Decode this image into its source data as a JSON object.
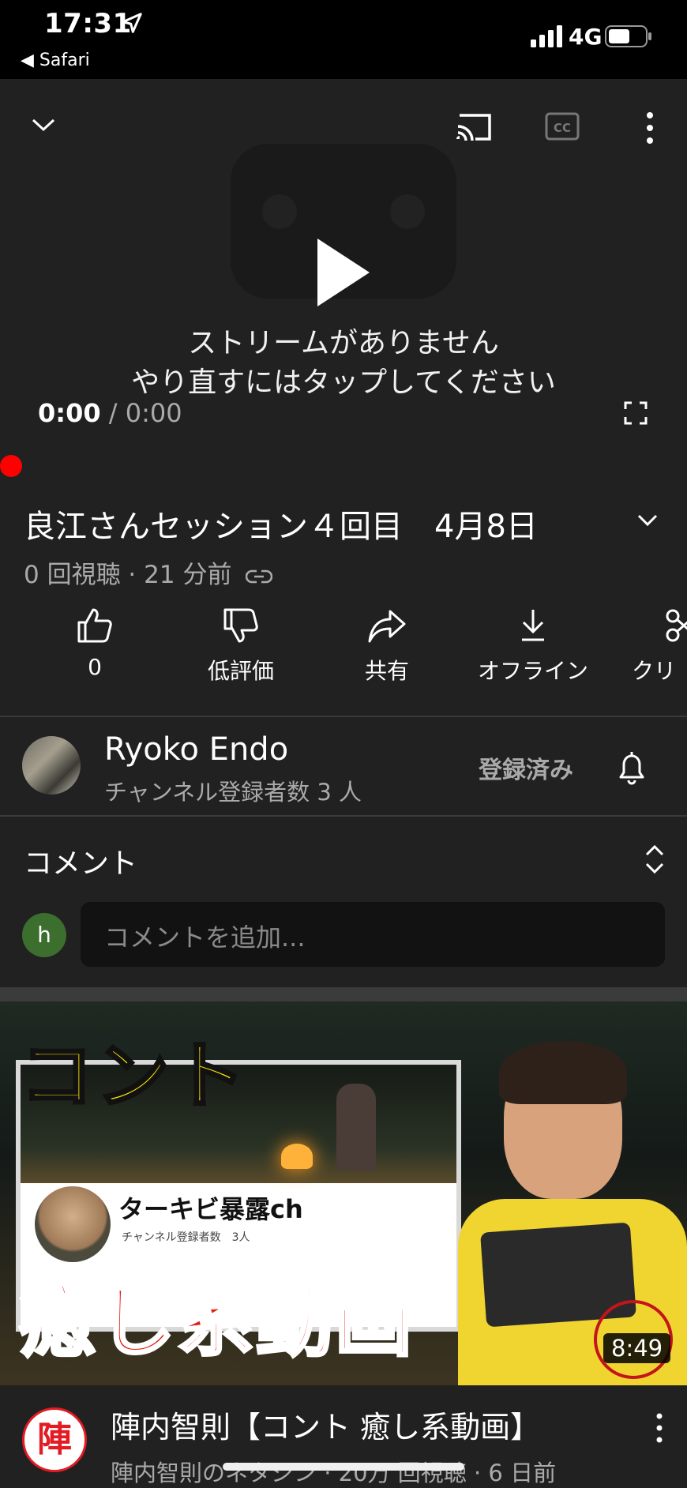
{
  "status_bar": {
    "time": "17:31",
    "back_app": "◀ Safari",
    "network": "4G"
  },
  "player": {
    "message_line1": "ストリームがありません",
    "message_line2": "やり直すにはタップしてください",
    "current_time": "0:00",
    "separator": " / ",
    "duration": "0:00",
    "progress": 0
  },
  "video": {
    "title": "良江さんセッション４回目　4月8日",
    "meta": "0 回視聴 · 21 分前"
  },
  "actions": [
    {
      "label": "0",
      "icon": "thumbs-up-icon"
    },
    {
      "label": "低評価",
      "icon": "thumbs-down-icon"
    },
    {
      "label": "共有",
      "icon": "share-icon"
    },
    {
      "label": "オフライン",
      "icon": "download-icon"
    },
    {
      "label": "クリ",
      "icon": "clip-icon"
    }
  ],
  "channel": {
    "name": "Ryoko Endo",
    "subscribers": "チャンネル登録者数 3 人",
    "subscribe_label": "登録済み"
  },
  "comments": {
    "title": "コメント",
    "avatar_letter": "h",
    "placeholder": "コメントを追加..."
  },
  "recommended": {
    "thumb_text_top": "コント",
    "thumb_channel": "ターキビ暴露ch",
    "thumb_channel_subs": "チャンネル登録者数　3人",
    "thumb_text_bottom": "癒し系動画",
    "duration": "8:49",
    "avatar_char": "陣",
    "title": "陣内智則【コント 癒し系動画】",
    "meta": "陣内智則のネタジン · 20万 回視聴 · 6 日前"
  },
  "colors": {
    "background": "#212121",
    "accent_red": "#ff0000",
    "text_secondary": "#aaaaaa"
  }
}
